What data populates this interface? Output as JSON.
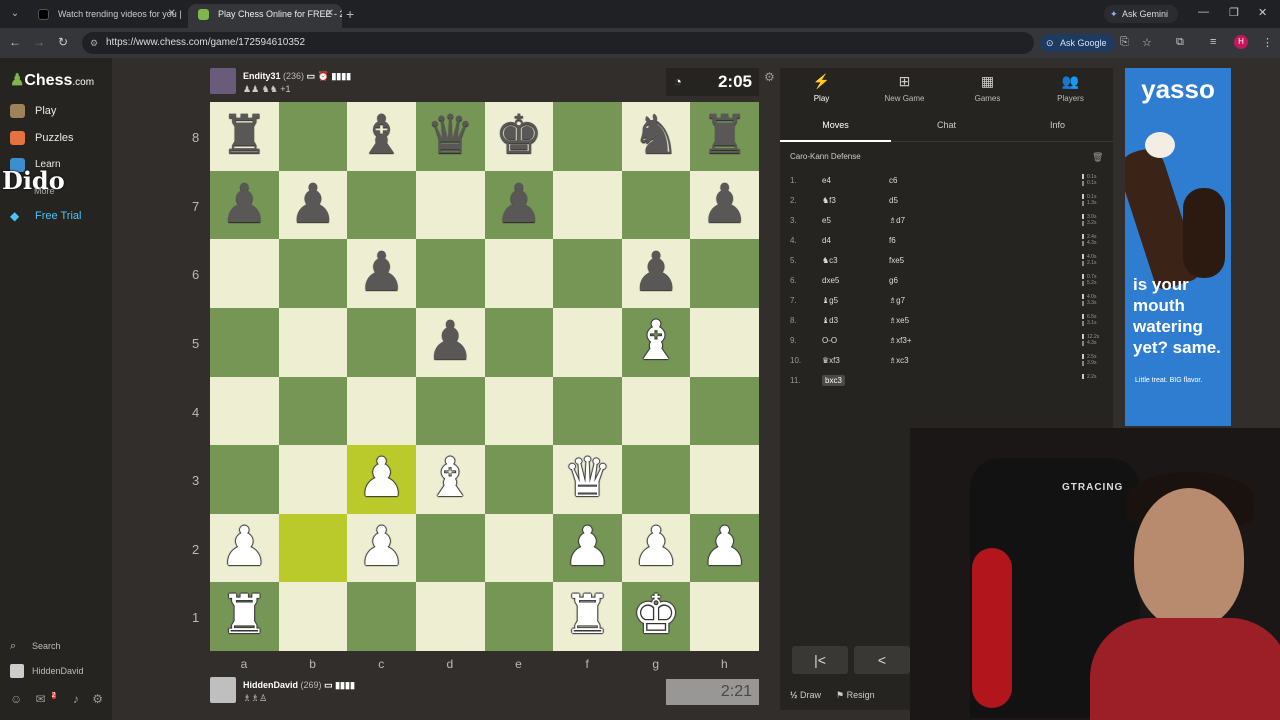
{
  "browser": {
    "tabs": [
      {
        "label": "Watch trending videos for you |",
        "active": false
      },
      {
        "label": "Play Chess Online for FREE - 2 P",
        "active": true
      }
    ],
    "ask_gemini": "Ask Gemini",
    "url": "https://www.chess.com/game/172594610352",
    "ask_google": "Ask Google",
    "profile_initial": "H"
  },
  "sidebar": {
    "logo_text": "Chess",
    "logo_suffix": ".com",
    "items": [
      {
        "label": "Play",
        "icon": "play-icon",
        "color": "#a0825a"
      },
      {
        "label": "Puzzles",
        "icon": "puzzle-icon",
        "color": "#e5733d"
      },
      {
        "label": "Learn",
        "icon": "learn-icon",
        "color": "#3b8fd1"
      }
    ],
    "overlay_text": "Dido",
    "more_label": "More",
    "free_trial": "Free Trial",
    "search_label": "Search",
    "username": "HiddenDavid",
    "notification_count": "2"
  },
  "top_player": {
    "name": "Endity31",
    "rating": "(236)",
    "captured": "♟♟ ♞♞ +1",
    "clock": "2:05"
  },
  "bottom_player": {
    "name": "HiddenDavid",
    "rating": "(269)",
    "captured": "♗♗♙",
    "clock": "2:21"
  },
  "board": {
    "ranks": [
      "8",
      "7",
      "6",
      "5",
      "4",
      "3",
      "2",
      "1"
    ],
    "files": [
      "a",
      "b",
      "c",
      "d",
      "e",
      "f",
      "g",
      "h"
    ],
    "position": [
      [
        "r",
        "",
        "b",
        "q",
        "k",
        "",
        "n",
        "r"
      ],
      [
        "p",
        "p",
        "",
        "",
        "p",
        "",
        "",
        "p"
      ],
      [
        "",
        "",
        "p",
        "",
        "",
        "",
        "p",
        ""
      ],
      [
        "",
        "",
        "",
        "p",
        "",
        "",
        "B",
        ""
      ],
      [
        "",
        "",
        "",
        "",
        "",
        "",
        "",
        ""
      ],
      [
        "",
        "",
        "P",
        "B",
        "",
        "Q",
        "",
        ""
      ],
      [
        "P",
        "",
        "P",
        "",
        "",
        "P",
        "P",
        "P"
      ],
      [
        "R",
        "",
        "",
        "",
        "",
        "R",
        "K",
        ""
      ]
    ],
    "highlighted": [
      "c3",
      "b2"
    ]
  },
  "panel": {
    "top_tabs": [
      {
        "label": "Play",
        "icon": "bolt-icon",
        "glyph": "⚡"
      },
      {
        "label": "New Game",
        "icon": "plus-icon",
        "glyph": "⊞"
      },
      {
        "label": "Games",
        "icon": "board-icon",
        "glyph": "▦"
      },
      {
        "label": "Players",
        "icon": "players-icon",
        "glyph": "👥"
      }
    ],
    "sub_tabs": [
      "Moves",
      "Chat",
      "Info"
    ],
    "opening": "Caro-Kann Defense",
    "moves": [
      {
        "num": "1.",
        "white": "e4",
        "black": "c6",
        "t1": "0.1s",
        "t2": "0.1s"
      },
      {
        "num": "2.",
        "white": "♞f3",
        "black": "d5",
        "t1": "0.1s",
        "t2": "1.3s"
      },
      {
        "num": "3.",
        "white": "e5",
        "black": "♗d7",
        "t1": "3.0s",
        "t2": "3.2s"
      },
      {
        "num": "4.",
        "white": "d4",
        "black": "f6",
        "t1": "2.4s",
        "t2": "4.3s"
      },
      {
        "num": "5.",
        "white": "♞c3",
        "black": "fxe5",
        "t1": "4.0s",
        "t2": "2.1s"
      },
      {
        "num": "6.",
        "white": "dxe5",
        "black": "g6",
        "t1": "0.7s",
        "t2": "5.2s"
      },
      {
        "num": "7.",
        "white": "♝g5",
        "black": "♗g7",
        "t1": "4.0s",
        "t2": "3.3s"
      },
      {
        "num": "8.",
        "white": "♝d3",
        "black": "♗xe5",
        "t1": "6.5s",
        "t2": "3.1s"
      },
      {
        "num": "9.",
        "white": "O-O",
        "black": "♗xf3+",
        "t1": "12.2s",
        "t2": "4.3s"
      },
      {
        "num": "10.",
        "white": "♛xf3",
        "black": "♗xc3",
        "t1": "2.5s",
        "t2": "3.9s"
      },
      {
        "num": "11.",
        "white": "bxc3",
        "black": "",
        "t1": "2.2s",
        "t2": ""
      }
    ],
    "draw_label": "Draw",
    "draw_prefix": "½",
    "resign_label": "Resign"
  },
  "ad": {
    "brand": "yasso",
    "tagline": "is your mouth watering yet? same.",
    "sub": "Little treat. BIG flavor.",
    "bg_color": "#2e7dd1"
  },
  "webcam": {
    "chair_text": "GTRACING"
  }
}
